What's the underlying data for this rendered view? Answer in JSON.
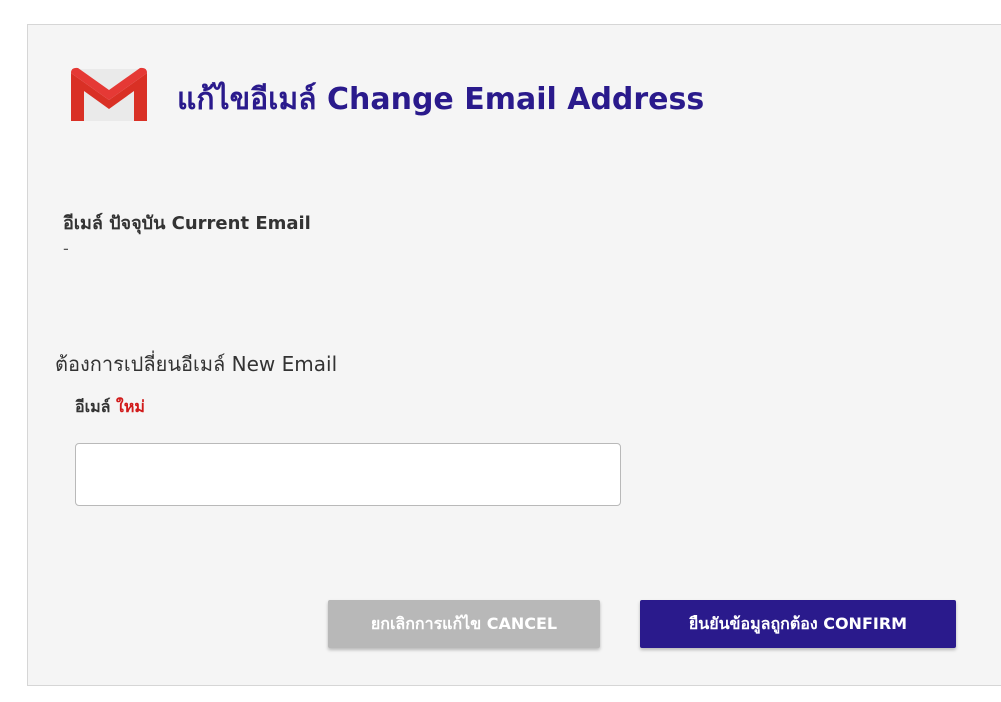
{
  "header": {
    "title": "แก้ไขอีเมล์ Change Email Address",
    "logo_icon": "gmail-icon"
  },
  "current_email": {
    "label": "อีเมล์ ปัจจุบัน Current Email",
    "value": "-"
  },
  "new_email": {
    "section_title": "ต้องการเปลี่ยนอีเมล์ New Email",
    "field_label": "อีเมล์",
    "field_label_required": "ใหม่",
    "value": ""
  },
  "actions": {
    "cancel_label": "ยกเลิกการแก้ไข CANCEL",
    "confirm_label": "ยืนยันข้อมูลถูกต้อง CONFIRM"
  },
  "colors": {
    "primary": "#2a1a8c",
    "cancel": "#b8b8b8",
    "required": "#d11a1a",
    "gmail_red": "#d93025"
  }
}
